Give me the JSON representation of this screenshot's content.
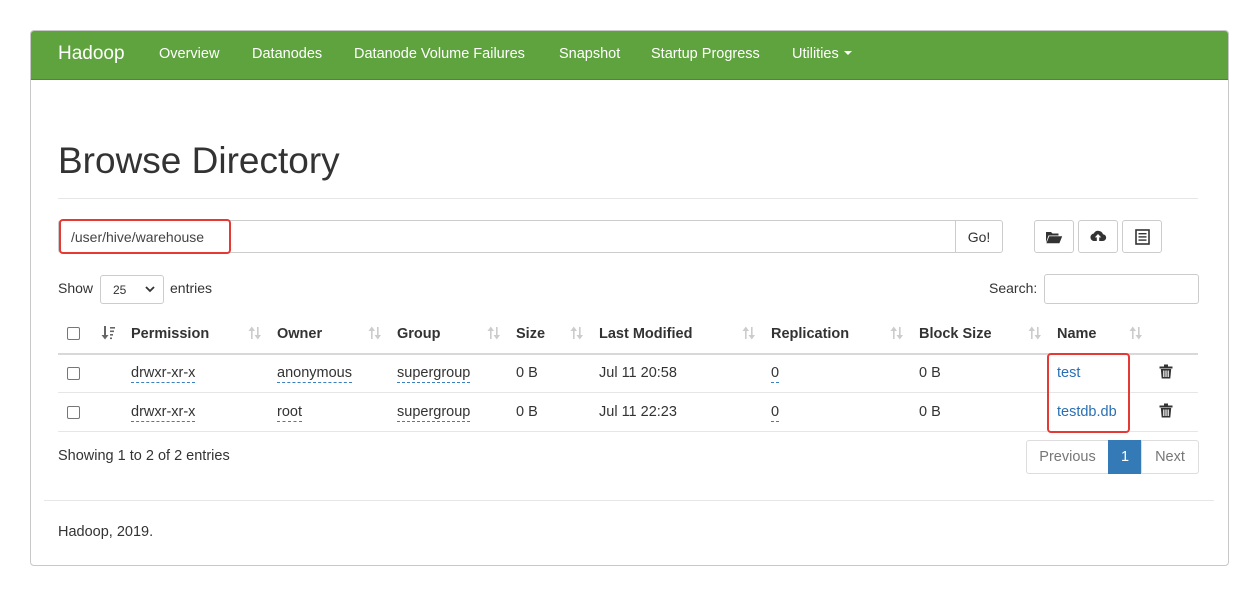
{
  "navbar": {
    "brand": "Hadoop",
    "items": [
      "Overview",
      "Datanodes",
      "Datanode Volume Failures",
      "Snapshot",
      "Startup Progress",
      "Utilities"
    ],
    "color": "#5fa33e"
  },
  "title": "Browse Directory",
  "path_bar": {
    "value": "/user/hive/warehouse",
    "go_label": "Go!",
    "icons": [
      "folder-open-icon",
      "cloud-upload-icon",
      "list-alt-icon"
    ]
  },
  "length_menu": {
    "show_label": "Show",
    "selected": "25",
    "entries_label": "entries"
  },
  "search": {
    "label": "Search:",
    "value": ""
  },
  "table": {
    "columns": [
      "Permission",
      "Owner",
      "Group",
      "Size",
      "Last Modified",
      "Replication",
      "Block Size",
      "Name"
    ],
    "rows": [
      {
        "permission": "drwxr-xr-x",
        "owner": "anonymous",
        "group": "supergroup",
        "size": "0 B",
        "last_modified": "Jul 11 20:58",
        "replication": "0",
        "block_size": "0 B",
        "name": "test"
      },
      {
        "permission": "drwxr-xr-x",
        "owner": "root",
        "group": "supergroup",
        "size": "0 B",
        "last_modified": "Jul 11 22:23",
        "replication": "0",
        "block_size": "0 B",
        "name": "testdb.db"
      }
    ]
  },
  "info_text": "Showing 1 to 2 of 2 entries",
  "pagination": {
    "previous": "Previous",
    "current": "1",
    "next": "Next"
  },
  "footer": "Hadoop, 2019.",
  "colors": {
    "accent": "#5fa33e",
    "link": "#2a6fb5",
    "active_page": "#337ab7",
    "highlight": "#e53935"
  }
}
